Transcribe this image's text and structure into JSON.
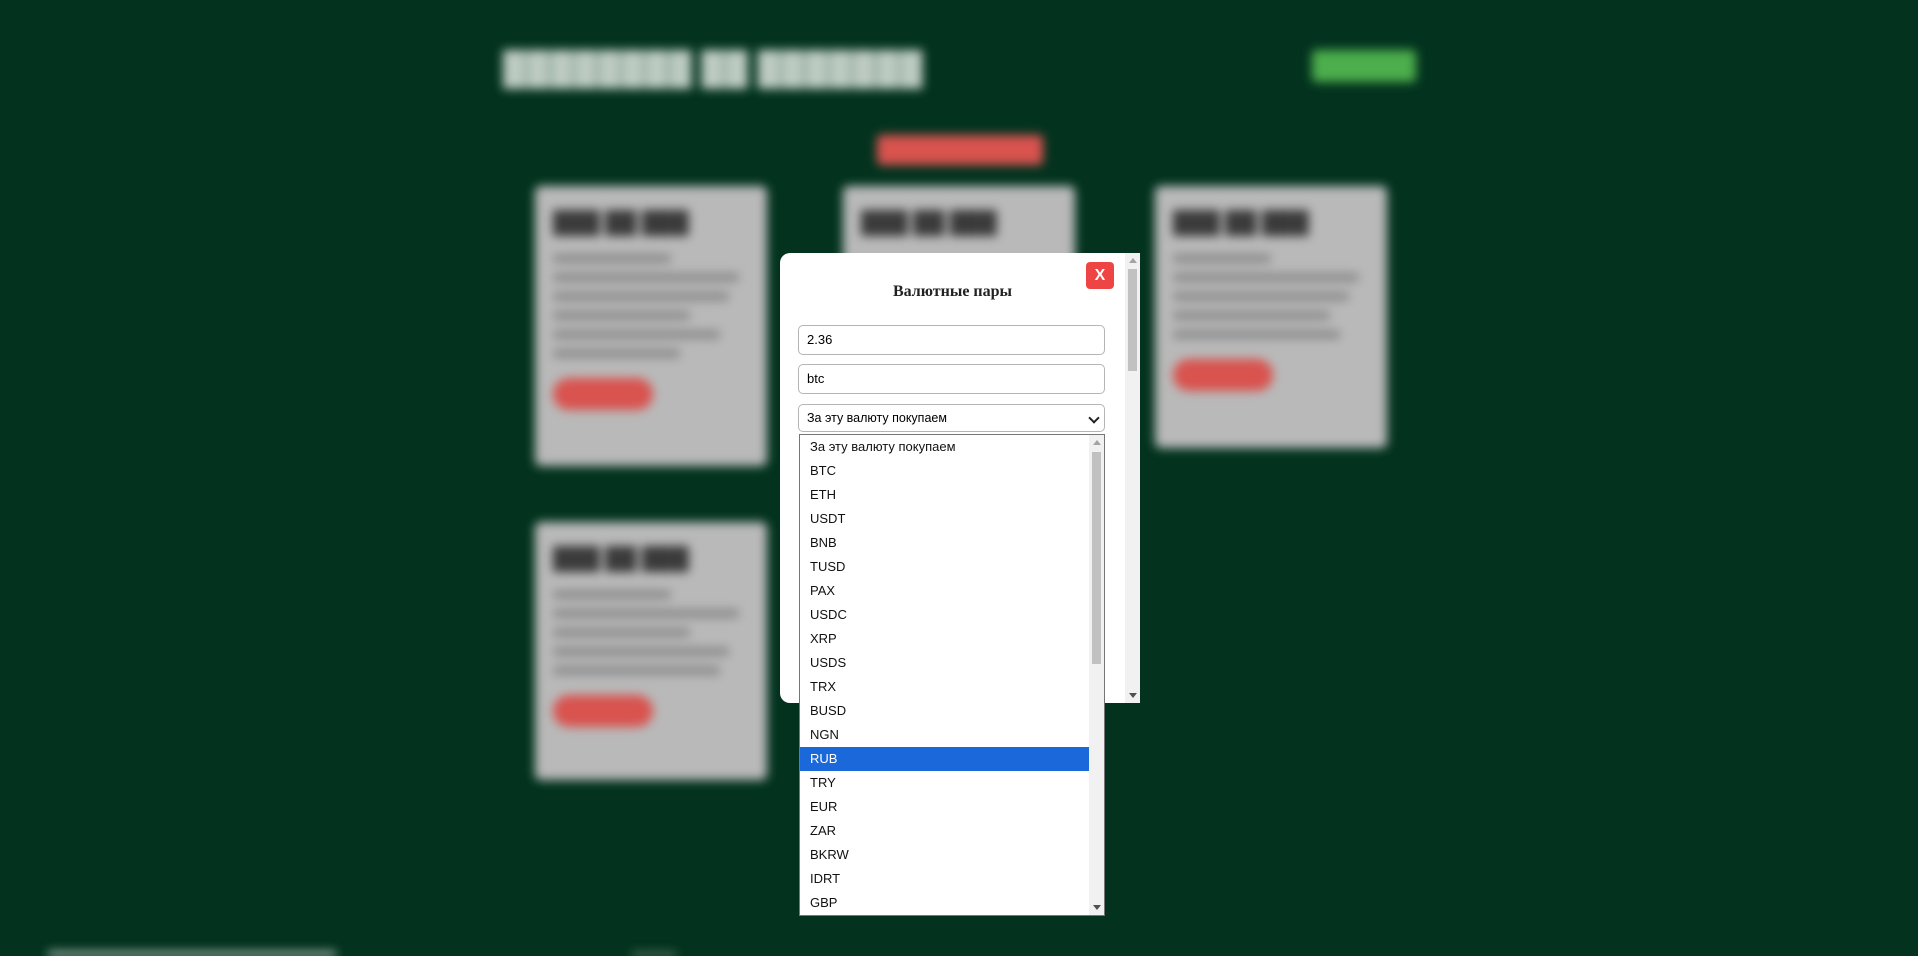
{
  "modal": {
    "title": "Валютные пары",
    "close_label": "X",
    "amount_value": "2.36",
    "coin_value": "btc",
    "select_value": "За эту валюту покупаем"
  },
  "dropdown": {
    "options": [
      "За эту валюту покупаем",
      "BTC",
      "ETH",
      "USDT",
      "BNB",
      "TUSD",
      "PAX",
      "USDC",
      "XRP",
      "USDS",
      "TRX",
      "BUSD",
      "NGN",
      "RUB",
      "TRY",
      "EUR",
      "ZAR",
      "BKRW",
      "IDRT",
      "GBP"
    ],
    "highlighted": "RUB"
  },
  "colors": {
    "page_background": "#03331f",
    "highlight": "#1a68d9",
    "close_button": "#ef4444",
    "background_green_button": "#4cae4c",
    "background_red_button": "#d9534f"
  },
  "icons": [
    "chevron-down-icon",
    "scroll-up-arrow-icon",
    "scroll-down-arrow-icon"
  ]
}
